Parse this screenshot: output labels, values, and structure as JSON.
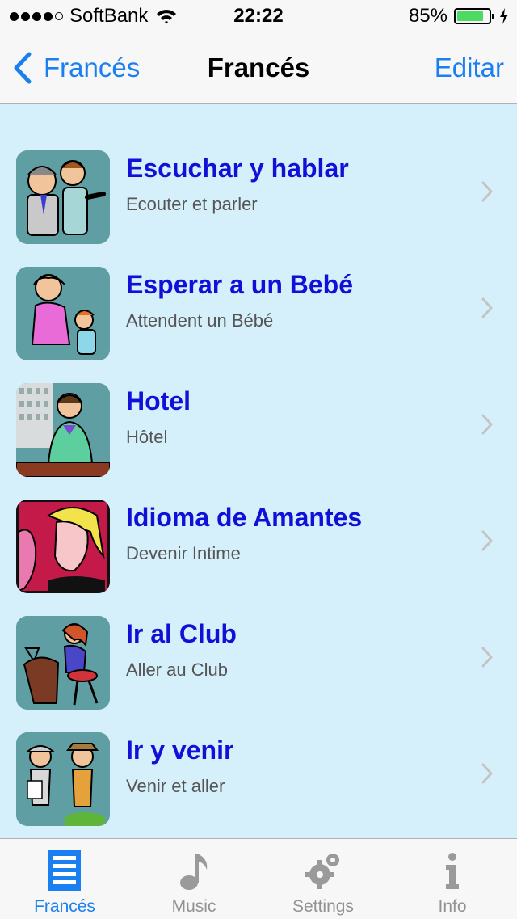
{
  "status_bar": {
    "carrier": "SoftBank",
    "time": "22:22",
    "battery": "85%",
    "battery_level": 0.85
  },
  "nav": {
    "back_label": "Francés",
    "title": "Francés",
    "edit_label": "Editar"
  },
  "items": [
    {
      "title": "Escuchar y hablar",
      "subtitle": "Ecouter et parler",
      "thumb_bg": "#5f9fa3"
    },
    {
      "title": "Esperar a un Bebé",
      "subtitle": "Attendent un Bébé",
      "thumb_bg": "#5f9fa3"
    },
    {
      "title": "Hotel",
      "subtitle": "Hôtel",
      "thumb_bg": "#5f9fa3"
    },
    {
      "title": "Idioma de Amantes",
      "subtitle": "Devenir Intime",
      "thumb_bg": "#c41a4a"
    },
    {
      "title": "Ir al Club",
      "subtitle": "Aller au Club",
      "thumb_bg": "#5f9fa3"
    },
    {
      "title": "Ir y venir",
      "subtitle": "Venir et aller",
      "thumb_bg": "#5f9fa3"
    }
  ],
  "tabs": [
    {
      "label": "Francés",
      "icon": "list-icon",
      "active": true
    },
    {
      "label": "Music",
      "icon": "music-note-icon",
      "active": false
    },
    {
      "label": "Settings",
      "icon": "gears-icon",
      "active": false
    },
    {
      "label": "Info",
      "icon": "info-icon",
      "active": false
    }
  ],
  "colors": {
    "accent": "#1a7ff0",
    "item_title": "#1010d8",
    "background": "#d6f0fb"
  }
}
